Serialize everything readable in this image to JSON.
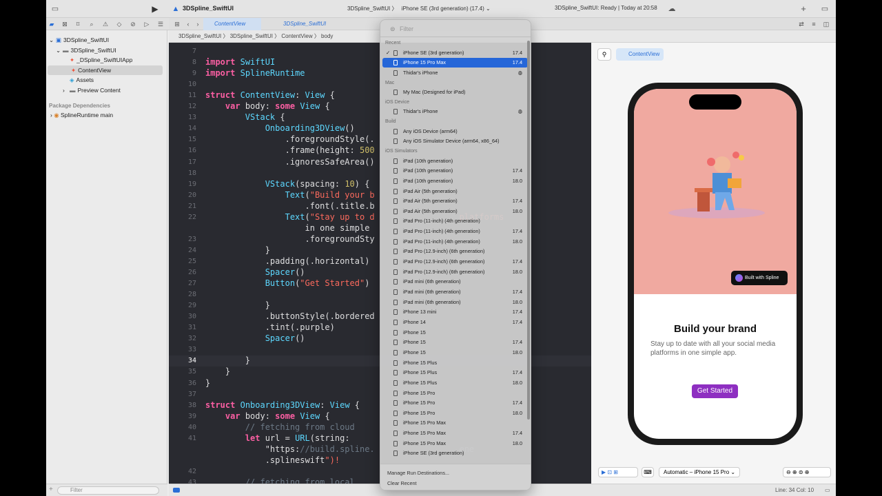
{
  "toolbar": {
    "project_title": "3DSpline_SwiftUI",
    "scheme": "3DSpline_SwiftUI 〉",
    "destination": "iPhone SE (3rd generation) (17.4) ⌄",
    "status": "3DSpline_SwiftUI: Ready | Today at 20:58"
  },
  "tabs": [
    {
      "label": "ContentView"
    },
    {
      "label": "3DSpline_SwiftUI"
    }
  ],
  "navigator": {
    "items": [
      {
        "label": "3DSpline_SwiftUI",
        "indent": 0,
        "disclosure": "⌄",
        "icon": "project-icon"
      },
      {
        "label": "3DSpline_SwiftUI",
        "indent": 1,
        "disclosure": "⌄",
        "icon": "folder-icon"
      },
      {
        "label": "_DSpline_SwiftUIApp",
        "indent": 2,
        "disclosure": "",
        "icon": "swift-file-icon"
      },
      {
        "label": "ContentView",
        "indent": 2,
        "disclosure": "",
        "icon": "swift-file-icon",
        "selected": true
      },
      {
        "label": "Assets",
        "indent": 2,
        "disclosure": "",
        "icon": "asset-catalog-icon"
      },
      {
        "label": "Preview Content",
        "indent": 2,
        "disclosure": "›",
        "icon": "folder-icon"
      }
    ],
    "package_header": "Package Dependencies",
    "package_item": "SplineRuntime main",
    "filter_placeholder": "Filter"
  },
  "jumpbar": {
    "path": "3DSpline_SwiftUI 〉 3DSpline_SwiftUI 〉 ContentView 〉 body"
  },
  "editor": {
    "lines": [
      {
        "n": "7",
        "t": ""
      },
      {
        "n": "8",
        "t": "import SwiftUI"
      },
      {
        "n": "9",
        "t": "import SplineRuntime"
      },
      {
        "n": "10",
        "t": ""
      },
      {
        "n": "11",
        "t": "struct ContentView: View {"
      },
      {
        "n": "12",
        "t": "    var body: some View {"
      },
      {
        "n": "13",
        "t": "        VStack {"
      },
      {
        "n": "14",
        "t": "            Onboarding3DView()"
      },
      {
        "n": "15",
        "t": "                .foregroundStyle(."
      },
      {
        "n": "16",
        "t": "                .frame(height: 500"
      },
      {
        "n": "17",
        "t": "                .ignoresSafeArea()"
      },
      {
        "n": "18",
        "t": ""
      },
      {
        "n": "19",
        "t": "            VStack(spacing: 10) {"
      },
      {
        "n": "20",
        "t": "                Text(\"Build your b"
      },
      {
        "n": "21",
        "t": "                    .font(.title.b"
      },
      {
        "n": "22",
        "t": "                Text(\"Stay up to d                 platforms"
      },
      {
        "n": "",
        "t": "                    in one simple"
      },
      {
        "n": "23",
        "t": "                    .foregroundSty"
      },
      {
        "n": "24",
        "t": "            }"
      },
      {
        "n": "25",
        "t": "            .padding(.horizontal)"
      },
      {
        "n": "26",
        "t": "            Spacer()"
      },
      {
        "n": "27",
        "t": "            Button(\"Get Started\")"
      },
      {
        "n": "28",
        "t": ""
      },
      {
        "n": "29",
        "t": "            }"
      },
      {
        "n": "30",
        "t": "            .buttonStyle(.bordered"
      },
      {
        "n": "31",
        "t": "            .tint(.purple)"
      },
      {
        "n": "32",
        "t": "            Spacer()"
      },
      {
        "n": "33",
        "t": ""
      },
      {
        "n": "34",
        "t": "        }"
      },
      {
        "n": "35",
        "t": "    }"
      },
      {
        "n": "36",
        "t": "}"
      },
      {
        "n": "37",
        "t": ""
      },
      {
        "n": "38",
        "t": "struct Onboarding3DView: View {"
      },
      {
        "n": "39",
        "t": "    var body: some View {"
      },
      {
        "n": "40",
        "t": "        // fetching from cloud"
      },
      {
        "n": "41",
        "t": "        let url = URL(string:"
      },
      {
        "n": "",
        "t": "            \"https://build.spline.                 ene"
      },
      {
        "n": "",
        "t": "            .splineswift\")!"
      },
      {
        "n": "42",
        "t": ""
      },
      {
        "n": "43",
        "t": "        // fetching from local"
      }
    ],
    "current_line": "34"
  },
  "popup": {
    "filter_placeholder": "Filter",
    "sections": [
      {
        "title": "Recent",
        "rows": [
          {
            "name": "iPhone SE (3rd generation)",
            "version": "17.4",
            "check": "✓"
          },
          {
            "name": "iPhone 15 Pro Max",
            "version": "17.4",
            "selected": true
          },
          {
            "name": "Thidar's iPhone",
            "version": "◍"
          }
        ]
      },
      {
        "title": "Mac",
        "rows": [
          {
            "name": "My Mac (Designed for iPad)",
            "version": ""
          }
        ]
      },
      {
        "title": "iOS Device",
        "rows": [
          {
            "name": "Thidar's iPhone",
            "version": "◍"
          }
        ]
      },
      {
        "title": "Build",
        "rows": [
          {
            "name": "Any iOS Device (arm64)",
            "version": ""
          },
          {
            "name": "Any iOS Simulator Device (arm64, x86_64)",
            "version": ""
          }
        ]
      },
      {
        "title": "iOS Simulators",
        "rows": [
          {
            "name": "iPad (10th generation)",
            "version": ""
          },
          {
            "name": "iPad (10th generation)",
            "version": "17.4"
          },
          {
            "name": "iPad (10th generation)",
            "version": "18.0"
          },
          {
            "name": "iPad Air (5th generation)",
            "version": ""
          },
          {
            "name": "iPad Air (5th generation)",
            "version": "17.4"
          },
          {
            "name": "iPad Air (5th generation)",
            "version": "18.0"
          },
          {
            "name": "iPad Pro (11-inch) (4th generation)",
            "version": ""
          },
          {
            "name": "iPad Pro (11-inch) (4th generation)",
            "version": "17.4"
          },
          {
            "name": "iPad Pro (11-inch) (4th generation)",
            "version": "18.0"
          },
          {
            "name": "iPad Pro (12.9-inch) (6th generation)",
            "version": ""
          },
          {
            "name": "iPad Pro (12.9-inch) (6th generation)",
            "version": "17.4"
          },
          {
            "name": "iPad Pro (12.9-inch) (6th generation)",
            "version": "18.0"
          },
          {
            "name": "iPad mini (6th generation)",
            "version": ""
          },
          {
            "name": "iPad mini (6th generation)",
            "version": "17.4"
          },
          {
            "name": "iPad mini (6th generation)",
            "version": "18.0"
          },
          {
            "name": "iPhone 13 mini",
            "version": "17.4"
          },
          {
            "name": "iPhone 14",
            "version": "17.4"
          },
          {
            "name": "iPhone 15",
            "version": ""
          },
          {
            "name": "iPhone 15",
            "version": "17.4"
          },
          {
            "name": "iPhone 15",
            "version": "18.0"
          },
          {
            "name": "iPhone 15 Plus",
            "version": ""
          },
          {
            "name": "iPhone 15 Plus",
            "version": "17.4"
          },
          {
            "name": "iPhone 15 Plus",
            "version": "18.0"
          },
          {
            "name": "iPhone 15 Pro",
            "version": ""
          },
          {
            "name": "iPhone 15 Pro",
            "version": "17.4"
          },
          {
            "name": "iPhone 15 Pro",
            "version": "18.0"
          },
          {
            "name": "iPhone 15 Pro Max",
            "version": ""
          },
          {
            "name": "iPhone 15 Pro Max",
            "version": "17.4"
          },
          {
            "name": "iPhone 15 Pro Max",
            "version": "18.0"
          },
          {
            "name": "iPhone SE (3rd generation)",
            "version": ""
          }
        ]
      }
    ],
    "manage_label": "Manage Run Destinations...",
    "clear_label": "Clear Recent"
  },
  "canvas": {
    "preview_chip": "ContentView",
    "device_selector": "Automatic – iPhone 15 Pro ⌄",
    "phone": {
      "badge": "Built with Spline",
      "title": "Build your brand",
      "subtitle": "Stay up to date with all your social media platforms in one simple app.",
      "button": "Get Started"
    }
  },
  "statusbar": {
    "position": "Line: 34  Col: 10"
  },
  "colors": {
    "accent": "#2566d8",
    "editor_bg": "#292a30",
    "keyword": "#fc5fa3",
    "type": "#5dd8ff",
    "string": "#fc6a5d",
    "comment": "#6c7986",
    "number": "#d0bf69",
    "purple_button": "#8e2fc1",
    "hero_bg": "#f0a9a0"
  }
}
